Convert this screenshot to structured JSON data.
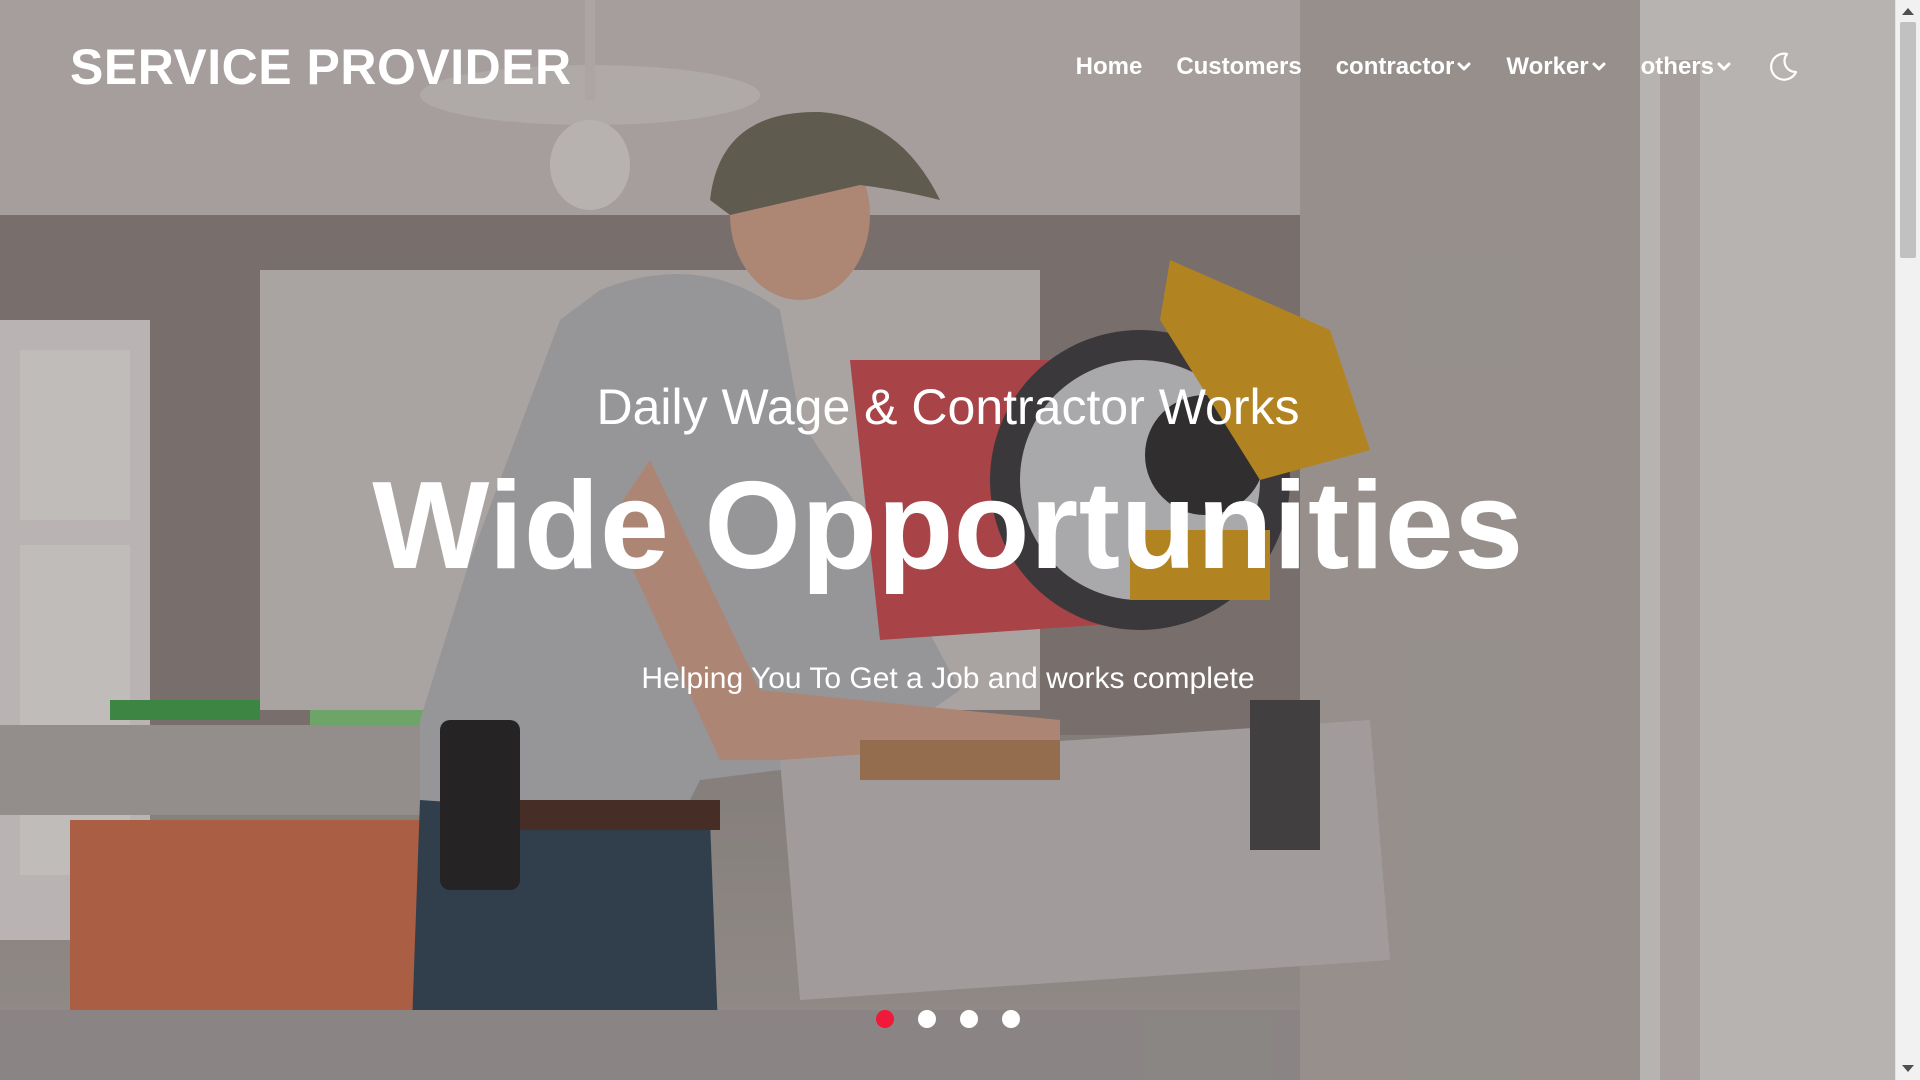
{
  "brand": {
    "name": "SERVICE PROVIDER"
  },
  "nav": {
    "items": [
      {
        "label": "Home",
        "has_dropdown": false
      },
      {
        "label": "Customers",
        "has_dropdown": false
      },
      {
        "label": "contractor",
        "has_dropdown": true
      },
      {
        "label": "Worker",
        "has_dropdown": true
      },
      {
        "label": "others",
        "has_dropdown": true
      }
    ],
    "theme_toggle_icon": "moon-icon"
  },
  "hero": {
    "eyebrow": "Daily Wage & Contractor Works",
    "headline": "Wide Opportunities",
    "subline": "Helping You To Get a Job and works complete",
    "background_description_icon": "workshop-photo",
    "carousel": {
      "slide_count": 4,
      "active_index": 0,
      "active_color": "#f0193a",
      "inactive_color": "#ffffff"
    }
  },
  "colors": {
    "text": "#ffffff",
    "accent": "#f0193a"
  }
}
